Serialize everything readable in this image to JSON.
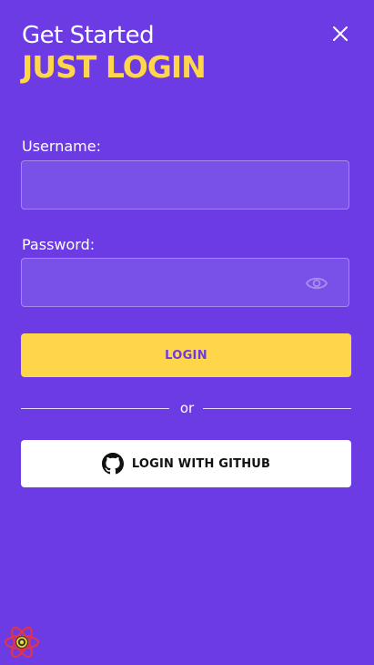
{
  "header": {
    "title": "Get Started",
    "subtitle": "JUST LOGIN",
    "close_icon": "close-icon"
  },
  "form": {
    "username_label": "Username:",
    "username_value": "",
    "password_label": "Password:",
    "password_value": "",
    "password_toggle_icon": "eye-icon",
    "login_label": "LOGIN"
  },
  "divider": {
    "text": "or"
  },
  "github": {
    "label": "LOGIN WITH GITHUB",
    "icon": "github-icon"
  },
  "devtools": {
    "icon": "react-logo-icon"
  },
  "colors": {
    "background": "#6c3be3",
    "accent": "#ffd549",
    "field_background": "#7a51e8",
    "github_button": "#ffffff"
  }
}
